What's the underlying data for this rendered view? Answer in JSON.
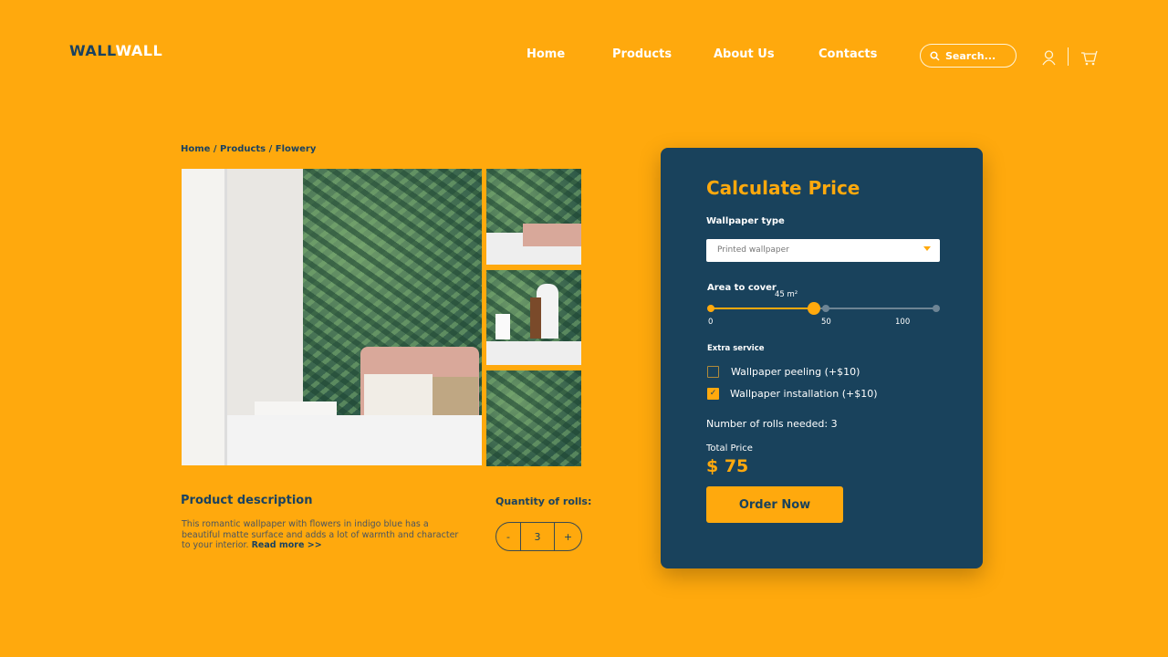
{
  "header": {
    "logo_a": "WALL",
    "logo_b": "WALL",
    "nav": [
      "Home",
      "Products",
      "About Us",
      "Contacts"
    ],
    "search_placeholder": "Search...",
    "icons": [
      "search-icon",
      "user-icon",
      "cart-icon"
    ]
  },
  "breadcrumb": "Home / Products / Flowery",
  "product": {
    "desc_title": "Product description",
    "desc_text": "This romantic wallpaper with flowers in indigo blue has a beautiful matte surface and adds a lot of warmth and character to your interior. ",
    "read_more": "Read more >>",
    "qty_label": "Quantity of rolls:",
    "qty_minus": "-",
    "qty_value": "3",
    "qty_plus": "+"
  },
  "calc": {
    "title": "Calculate Price",
    "type_label": "Wallpaper type",
    "type_value": "Printed wallpaper",
    "area_label": "Area to cover",
    "area_value_label": "45 m²",
    "area_value": 45,
    "ticks": [
      "0",
      "50",
      "100"
    ],
    "extra_label": "Extra service",
    "options": [
      {
        "label": "Wallpaper peeling (+$10)",
        "checked": false
      },
      {
        "label": "Wallpaper installation (+$10)",
        "checked": true
      }
    ],
    "rolls": "Number of rolls needed: 3",
    "total_label": "Total Price",
    "total": "$ 75",
    "order": "Order Now"
  },
  "colors": {
    "background": "#FFA90D",
    "card": "#19425c",
    "accent": "#FFA90D"
  }
}
